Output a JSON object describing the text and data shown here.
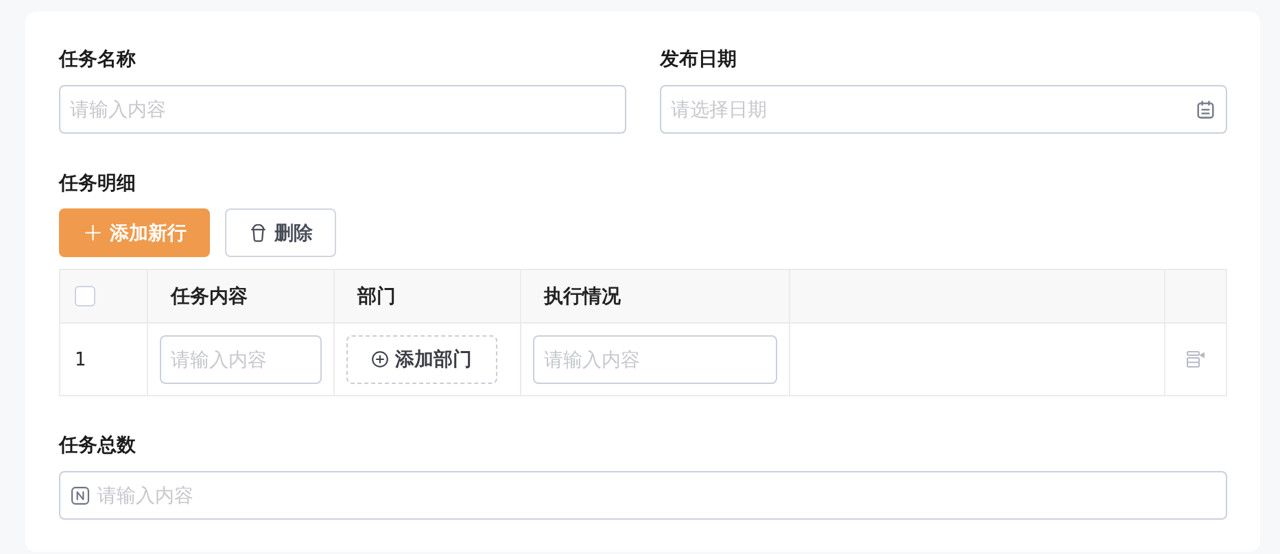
{
  "fields": [
    {
      "label": "任务名称",
      "kind": "text",
      "placeholder": "请输入内容"
    },
    {
      "label": "发布日期",
      "kind": "date",
      "placeholder": "请选择日期"
    }
  ],
  "details": {
    "label": "任务明细",
    "buttons": [
      {
        "label": "添加新行",
        "kind": "primary"
      },
      {
        "label": "删除",
        "kind": "default"
      }
    ],
    "table": {
      "select_all": {
        "checked": false
      },
      "columns": [
        {
          "label": "任务内容"
        },
        {
          "label": "部门"
        },
        {
          "label": "执行情况"
        }
      ],
      "rows": [
        {
          "index": "1",
          "cells": [
            {
              "kind": "input",
              "placeholder": "请输入内容"
            },
            {
              "kind": "add_button",
              "label": "添加部门"
            },
            {
              "kind": "input",
              "placeholder": "请输入内容"
            }
          ]
        }
      ]
    }
  },
  "total": {
    "label": "任务总数",
    "kind": "number",
    "placeholder": "请输入内容"
  }
}
